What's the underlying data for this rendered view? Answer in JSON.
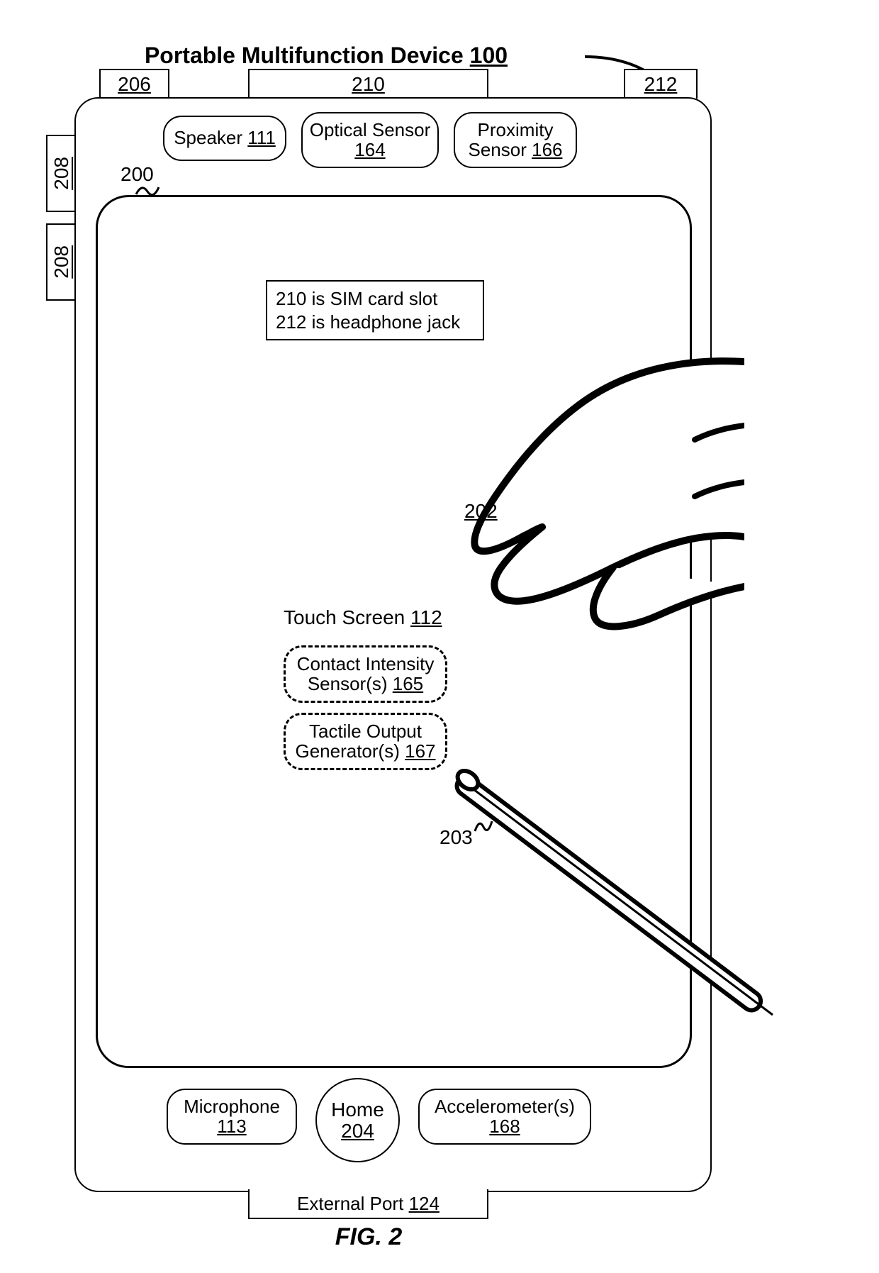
{
  "title": {
    "label": "Portable Multifunction Device",
    "num": "100"
  },
  "figure_label": "FIG. 2",
  "top_tabs": {
    "left": "206",
    "mid": "210",
    "right": "212"
  },
  "side_tabs": {
    "top": "208",
    "bottom": "208"
  },
  "top_row": {
    "speaker": {
      "label": "Speaker",
      "num": "111"
    },
    "optical": {
      "label": "Optical Sensor",
      "num": "164"
    },
    "proximity": {
      "label_l1": "Proximity",
      "label_l2": "Sensor",
      "num": "166"
    }
  },
  "screen_ref_200": "200",
  "info_box": {
    "l1": "210 is SIM card slot",
    "l2": "212 is headphone jack"
  },
  "hand_ref": "202",
  "touch_screen": {
    "label": "Touch Screen",
    "num": "112"
  },
  "intensity": {
    "label_l1": "Contact Intensity",
    "label_l2": "Sensor(s)",
    "num": "165"
  },
  "tactile": {
    "label_l1": "Tactile Output",
    "label_l2": "Generator(s)",
    "num": "167"
  },
  "stylus_ref": "203",
  "bottom_row": {
    "mic": {
      "label": "Microphone",
      "num": "113"
    },
    "home": {
      "label": "Home",
      "num": "204"
    },
    "accel": {
      "label": "Accelerometer(s)",
      "num": "168"
    }
  },
  "external_port": {
    "label": "External Port",
    "num": "124"
  }
}
